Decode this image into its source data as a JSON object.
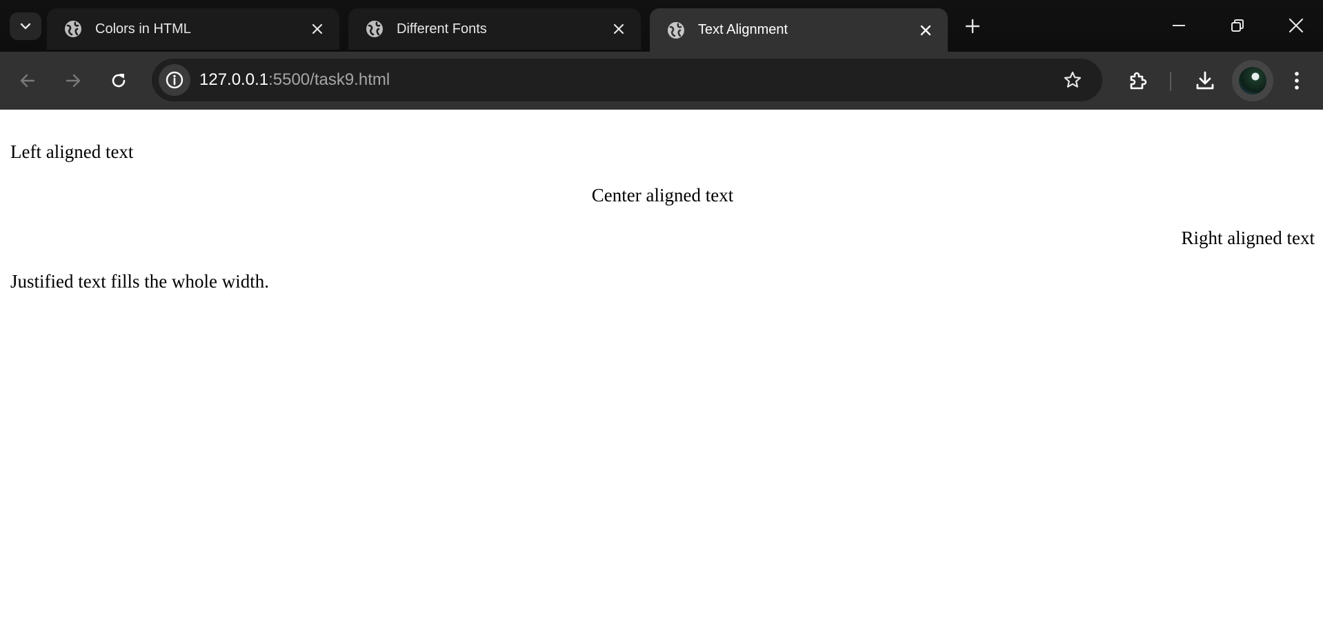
{
  "browser": {
    "tabs": [
      {
        "title": "Colors in HTML",
        "active": false
      },
      {
        "title": "Different Fonts",
        "active": false
      },
      {
        "title": "Text Alignment",
        "active": true
      }
    ],
    "address": {
      "host": "127.0.0.1",
      "path": ":5500/task9.html"
    },
    "icons": {
      "tab_search": "chevron-down-icon",
      "favicon": "globe-icon",
      "tab_close": "close-icon",
      "new_tab": "plus-icon",
      "minimize": "minimize-icon",
      "restore": "restore-icon",
      "window_close": "close-icon",
      "back": "arrow-left-icon",
      "forward": "arrow-right-icon",
      "reload": "reload-icon",
      "site_info": "info-icon",
      "bookmark": "star-icon",
      "extensions": "puzzle-icon",
      "downloads": "download-icon",
      "profile": "avatar",
      "menu": "kebab-menu-icon"
    }
  },
  "page": {
    "left_text": "Left aligned text",
    "center_text": "Center aligned text",
    "right_text": "Right aligned text",
    "justify_text": "Justified text fills the whole width."
  }
}
